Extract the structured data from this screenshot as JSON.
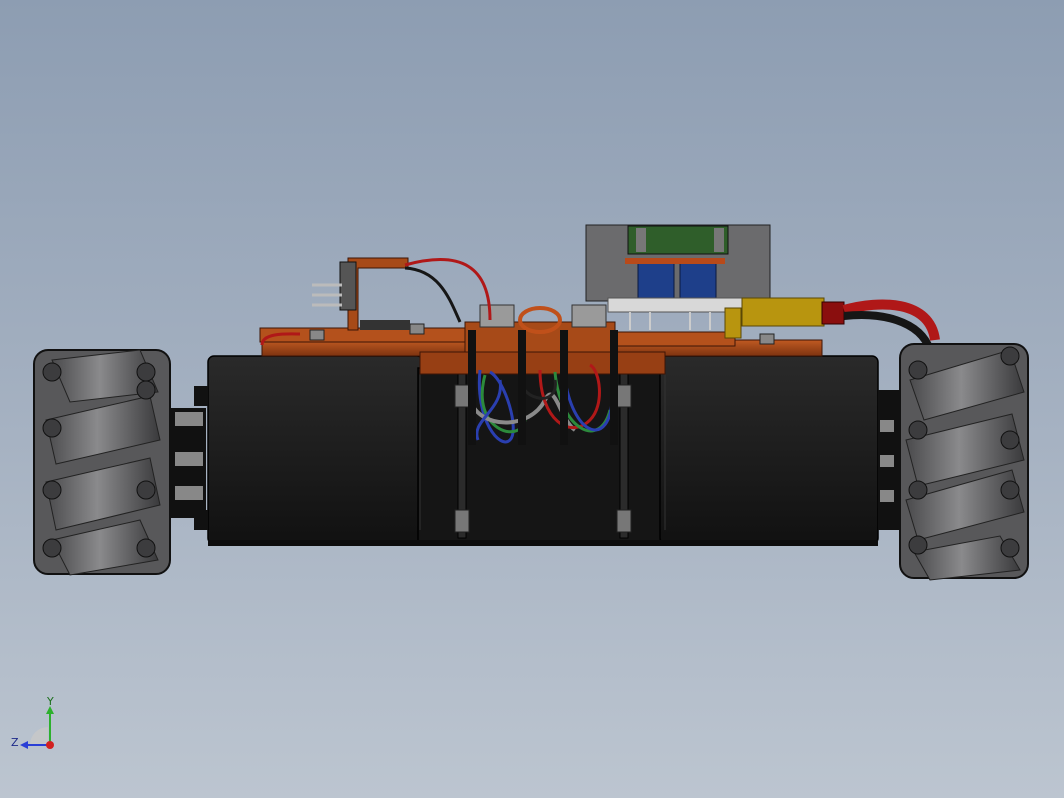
{
  "viewport": {
    "colors": {
      "bg_top": "#8d9db2",
      "bg_bottom": "#bcc5d0",
      "motor_body": "#1c1c1c",
      "chassis_plate": "#a34718",
      "wheel_roller": "#6e6e70",
      "wire_red": "#b01818",
      "wire_black": "#161616",
      "wire_blue": "#2a3fb0",
      "wire_green": "#2c8a3c",
      "board_green": "#2f5e2a",
      "board_blue": "#1e3f8a",
      "connector_yellow": "#b8950f"
    }
  },
  "triad": {
    "y_label": "Y",
    "z_label": "Z",
    "axes": {
      "y": "#2db02d",
      "z": "#2a3fd6",
      "x_origin": "#d22020"
    }
  }
}
